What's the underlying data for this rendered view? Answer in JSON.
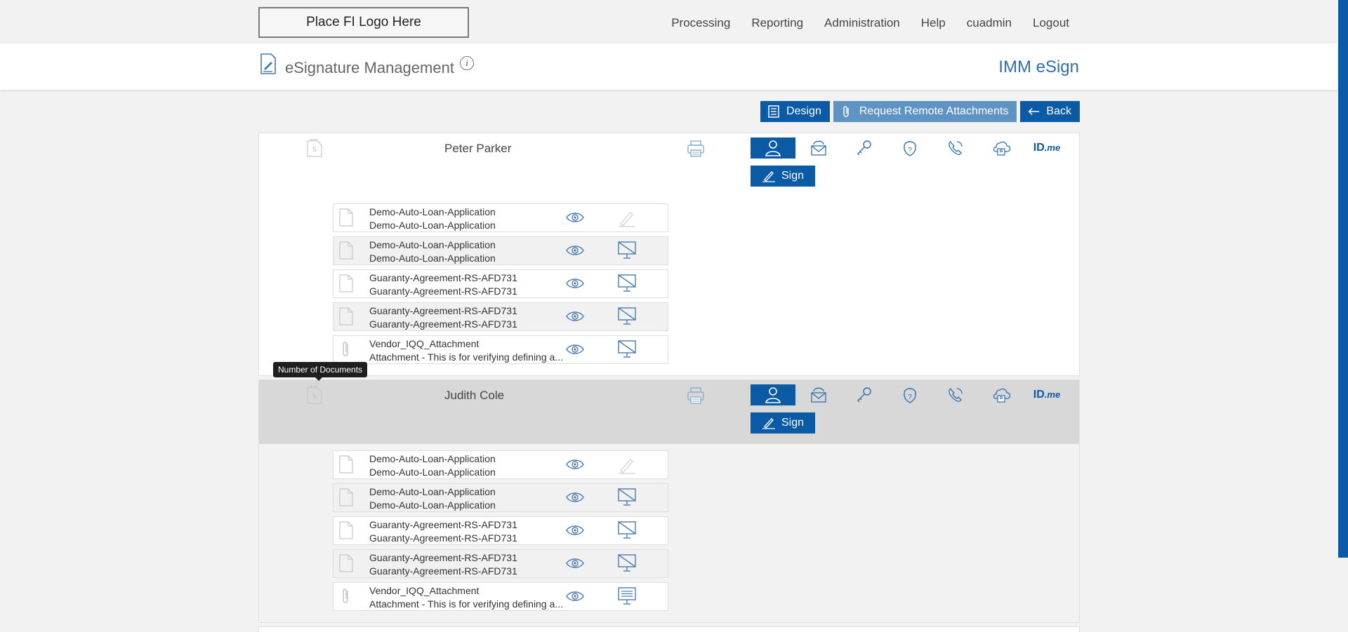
{
  "header": {
    "logo_text": "Place FI Logo Here",
    "nav": [
      "Processing",
      "Reporting",
      "Administration",
      "Help",
      "cuadmin",
      "Logout"
    ]
  },
  "titlebar": {
    "title": "eSignature Management",
    "info_glyph": "i",
    "brand": "IMM eSign"
  },
  "toolbar": {
    "design_label": "Design",
    "remote_label": "Request Remote Attachments",
    "back_label": "Back"
  },
  "colors": {
    "accent": "#0a5aa6",
    "accent_light": "#5e93c4"
  },
  "tooltip": "Number of Documents",
  "auth_methods": [
    "in-person-icon",
    "email-icon",
    "key-icon",
    "security-question-icon",
    "phone-icon",
    "cloud-id-icon",
    "idme-icon"
  ],
  "idme": {
    "main": "ID",
    "suffix": ".me"
  },
  "sign_label": "Sign",
  "signers": [
    {
      "name": "Peter Parker",
      "doc_count": "5",
      "documents": [
        {
          "line1": "Demo-Auto-Loan-Application",
          "line2": "Demo-Auto-Loan-Application",
          "type": "document-icon",
          "status": "signed-pen-icon"
        },
        {
          "line1": "Demo-Auto-Loan-Application",
          "line2": "Demo-Auto-Loan-Application",
          "type": "document-icon",
          "status": "not-viewed-monitor-icon"
        },
        {
          "line1": "Guaranty-Agreement-RS-AFD731",
          "line2": "Guaranty-Agreement-RS-AFD731",
          "type": "document-icon",
          "status": "not-viewed-monitor-icon"
        },
        {
          "line1": "Guaranty-Agreement-RS-AFD731",
          "line2": "Guaranty-Agreement-RS-AFD731",
          "type": "document-icon",
          "status": "not-viewed-monitor-icon"
        },
        {
          "line1": "Vendor_IQQ_Attachment",
          "line2": "Attachment - This is for verifying defining a...",
          "type": "paperclip-icon",
          "status": "not-viewed-monitor-icon"
        }
      ]
    },
    {
      "name": "Judith Cole",
      "doc_count": "5",
      "documents": [
        {
          "line1": "Demo-Auto-Loan-Application",
          "line2": "Demo-Auto-Loan-Application",
          "type": "document-icon",
          "status": "signed-pen-icon"
        },
        {
          "line1": "Demo-Auto-Loan-Application",
          "line2": "Demo-Auto-Loan-Application",
          "type": "document-icon",
          "status": "not-viewed-monitor-icon"
        },
        {
          "line1": "Guaranty-Agreement-RS-AFD731",
          "line2": "Guaranty-Agreement-RS-AFD731",
          "type": "document-icon",
          "status": "not-viewed-monitor-icon"
        },
        {
          "line1": "Guaranty-Agreement-RS-AFD731",
          "line2": "Guaranty-Agreement-RS-AFD731",
          "type": "document-icon",
          "status": "not-viewed-monitor-icon"
        },
        {
          "line1": "Vendor_IQQ_Attachment",
          "line2": "Attachment - This is for verifying defining a...",
          "type": "paperclip-icon",
          "status": "viewed-monitor-icon"
        }
      ]
    }
  ]
}
